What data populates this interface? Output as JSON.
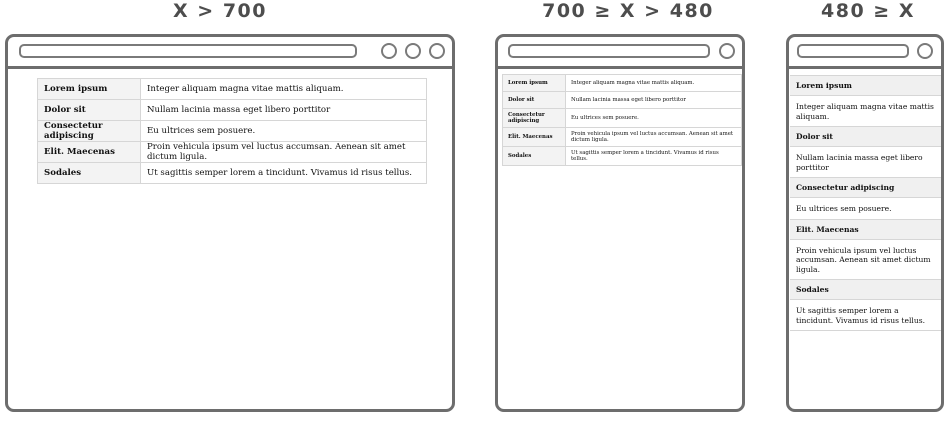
{
  "breakpoints": [
    {
      "label": "X > 700"
    },
    {
      "label": "700 ≥ X > 480"
    },
    {
      "label": "480 ≥ X"
    }
  ],
  "rows": [
    {
      "key": "Lorem ipsum",
      "value": "Integer aliquam magna vitae mattis aliquam."
    },
    {
      "key": "Dolor sit",
      "value": "Nullam lacinia massa eget libero porttitor"
    },
    {
      "key": "Consectetur adipiscing",
      "value": "Eu ultrices sem posuere."
    },
    {
      "key": "Elit. Maecenas",
      "value": "Proin vehicula ipsum vel luctus accumsan. Aenean sit amet dictum ligula."
    },
    {
      "key": "Sodales",
      "value": "Ut sagittis semper lorem a tincidunt. Vivamus id risus tellus."
    }
  ]
}
